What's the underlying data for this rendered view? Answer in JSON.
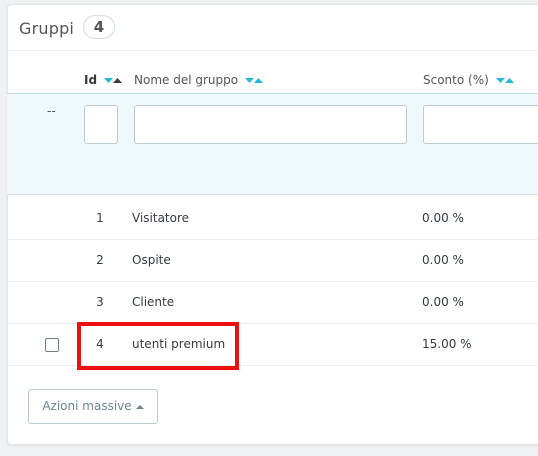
{
  "panel": {
    "title": "Gruppi",
    "count": "4"
  },
  "table": {
    "columns": {
      "id": "Id",
      "name": "Nome del gruppo",
      "discount": "Sconto (%)"
    },
    "filter": {
      "dash": "--",
      "id_value": "",
      "name_value": "",
      "discount_value": ""
    },
    "rows": [
      {
        "id": "1",
        "name": "Visitatore",
        "discount": "0.00 %"
      },
      {
        "id": "2",
        "name": "Ospite",
        "discount": "0.00 %"
      },
      {
        "id": "3",
        "name": "Cliente",
        "discount": "0.00 %"
      },
      {
        "id": "4",
        "name": "utenti premium",
        "discount": "15.00 %"
      }
    ]
  },
  "actions": {
    "bulk_label": "Azioni massive"
  },
  "colors": {
    "sort_active": "#25b9d7",
    "highlight": "#ec1111"
  },
  "icons": {
    "sort_desc": "caret-down-icon",
    "sort_asc": "caret-up-icon"
  }
}
